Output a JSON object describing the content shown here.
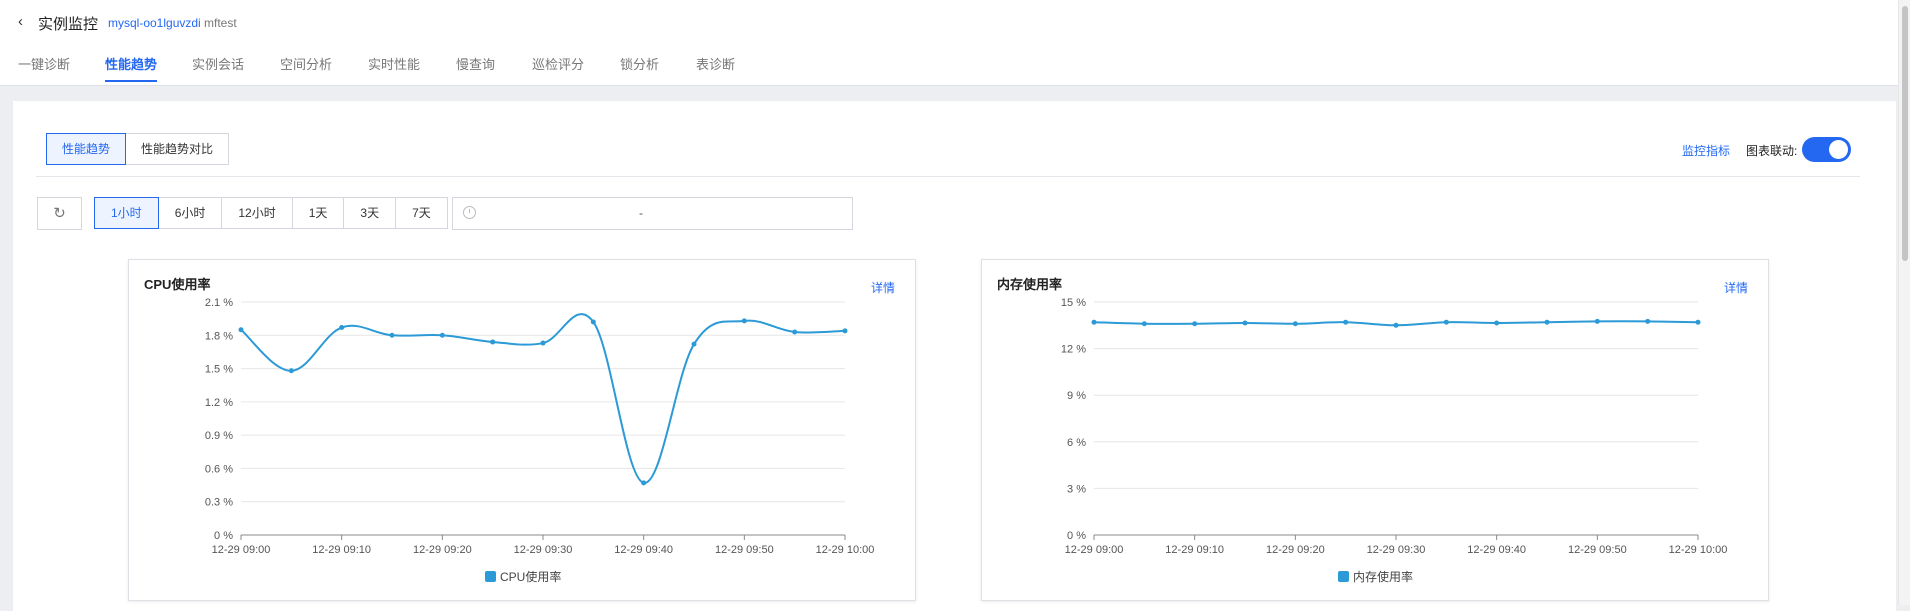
{
  "header": {
    "title": "实例监控",
    "instance_id": "mysql-oo1lguvzdi",
    "instance_name": "mftest",
    "back_icon": "chevron-left-icon"
  },
  "tabs": [
    {
      "label": "一键诊断",
      "active": false
    },
    {
      "label": "性能趋势",
      "active": true
    },
    {
      "label": "实例会话",
      "active": false
    },
    {
      "label": "空间分析",
      "active": false
    },
    {
      "label": "实时性能",
      "active": false
    },
    {
      "label": "慢查询",
      "active": false
    },
    {
      "label": "巡检评分",
      "active": false
    },
    {
      "label": "锁分析",
      "active": false
    },
    {
      "label": "表诊断",
      "active": false
    }
  ],
  "view_switch": [
    {
      "label": "性能趋势",
      "active": true
    },
    {
      "label": "性能趋势对比",
      "active": false
    }
  ],
  "toolbar": {
    "monitor_link": "监控指标",
    "chart_link_label": "图表联动:",
    "chart_link_on": true,
    "refresh_icon": "refresh-icon",
    "time_ranges": [
      {
        "label": "1小时",
        "active": true
      },
      {
        "label": "6小时",
        "active": false
      },
      {
        "label": "12小时",
        "active": false
      },
      {
        "label": "1天",
        "active": false
      },
      {
        "label": "3天",
        "active": false
      },
      {
        "label": "7天",
        "active": false
      }
    ],
    "date_range_separator": "-",
    "clock_icon": "clock-icon"
  },
  "colors": {
    "accent": "#2468f2",
    "series": "#2b9ad6"
  },
  "chart_data": [
    {
      "type": "line",
      "title": "CPU使用率",
      "detail_label": "详情",
      "x": [
        "12-29 09:00",
        "12-29 09:05",
        "12-29 09:10",
        "12-29 09:15",
        "12-29 09:20",
        "12-29 09:25",
        "12-29 09:30",
        "12-29 09:35",
        "12-29 09:40",
        "12-29 09:45",
        "12-29 09:50",
        "12-29 09:55",
        "12-29 10:00"
      ],
      "x_ticks": [
        "12-29 09:00",
        "12-29 09:10",
        "12-29 09:20",
        "12-29 09:30",
        "12-29 09:40",
        "12-29 09:50",
        "12-29 10:00"
      ],
      "series": [
        {
          "name": "CPU使用率",
          "values": [
            1.85,
            1.48,
            1.87,
            1.8,
            1.8,
            1.74,
            1.73,
            1.92,
            0.47,
            1.72,
            1.93,
            1.83,
            1.84
          ]
        }
      ],
      "y_ticks": [
        "0 %",
        "0.3 %",
        "0.6 %",
        "0.9 %",
        "1.2 %",
        "1.5 %",
        "1.8 %",
        "2.1 %"
      ],
      "ylim": [
        0,
        2.1
      ],
      "legend": "bottom-center",
      "grid": true
    },
    {
      "type": "line",
      "title": "内存使用率",
      "detail_label": "详情",
      "x": [
        "12-29 09:00",
        "12-29 09:05",
        "12-29 09:10",
        "12-29 09:15",
        "12-29 09:20",
        "12-29 09:25",
        "12-29 09:30",
        "12-29 09:35",
        "12-29 09:40",
        "12-29 09:45",
        "12-29 09:50",
        "12-29 09:55",
        "12-29 10:00"
      ],
      "x_ticks": [
        "12-29 09:00",
        "12-29 09:10",
        "12-29 09:20",
        "12-29 09:30",
        "12-29 09:40",
        "12-29 09:50",
        "12-29 10:00"
      ],
      "series": [
        {
          "name": "内存使用率",
          "values": [
            13.7,
            13.6,
            13.6,
            13.65,
            13.6,
            13.7,
            13.5,
            13.7,
            13.65,
            13.7,
            13.75,
            13.75,
            13.7
          ]
        }
      ],
      "y_ticks": [
        "0 %",
        "3 %",
        "6 %",
        "9 %",
        "12 %",
        "15 %"
      ],
      "ylim": [
        0,
        15
      ],
      "legend": "bottom-center",
      "grid": true
    }
  ]
}
